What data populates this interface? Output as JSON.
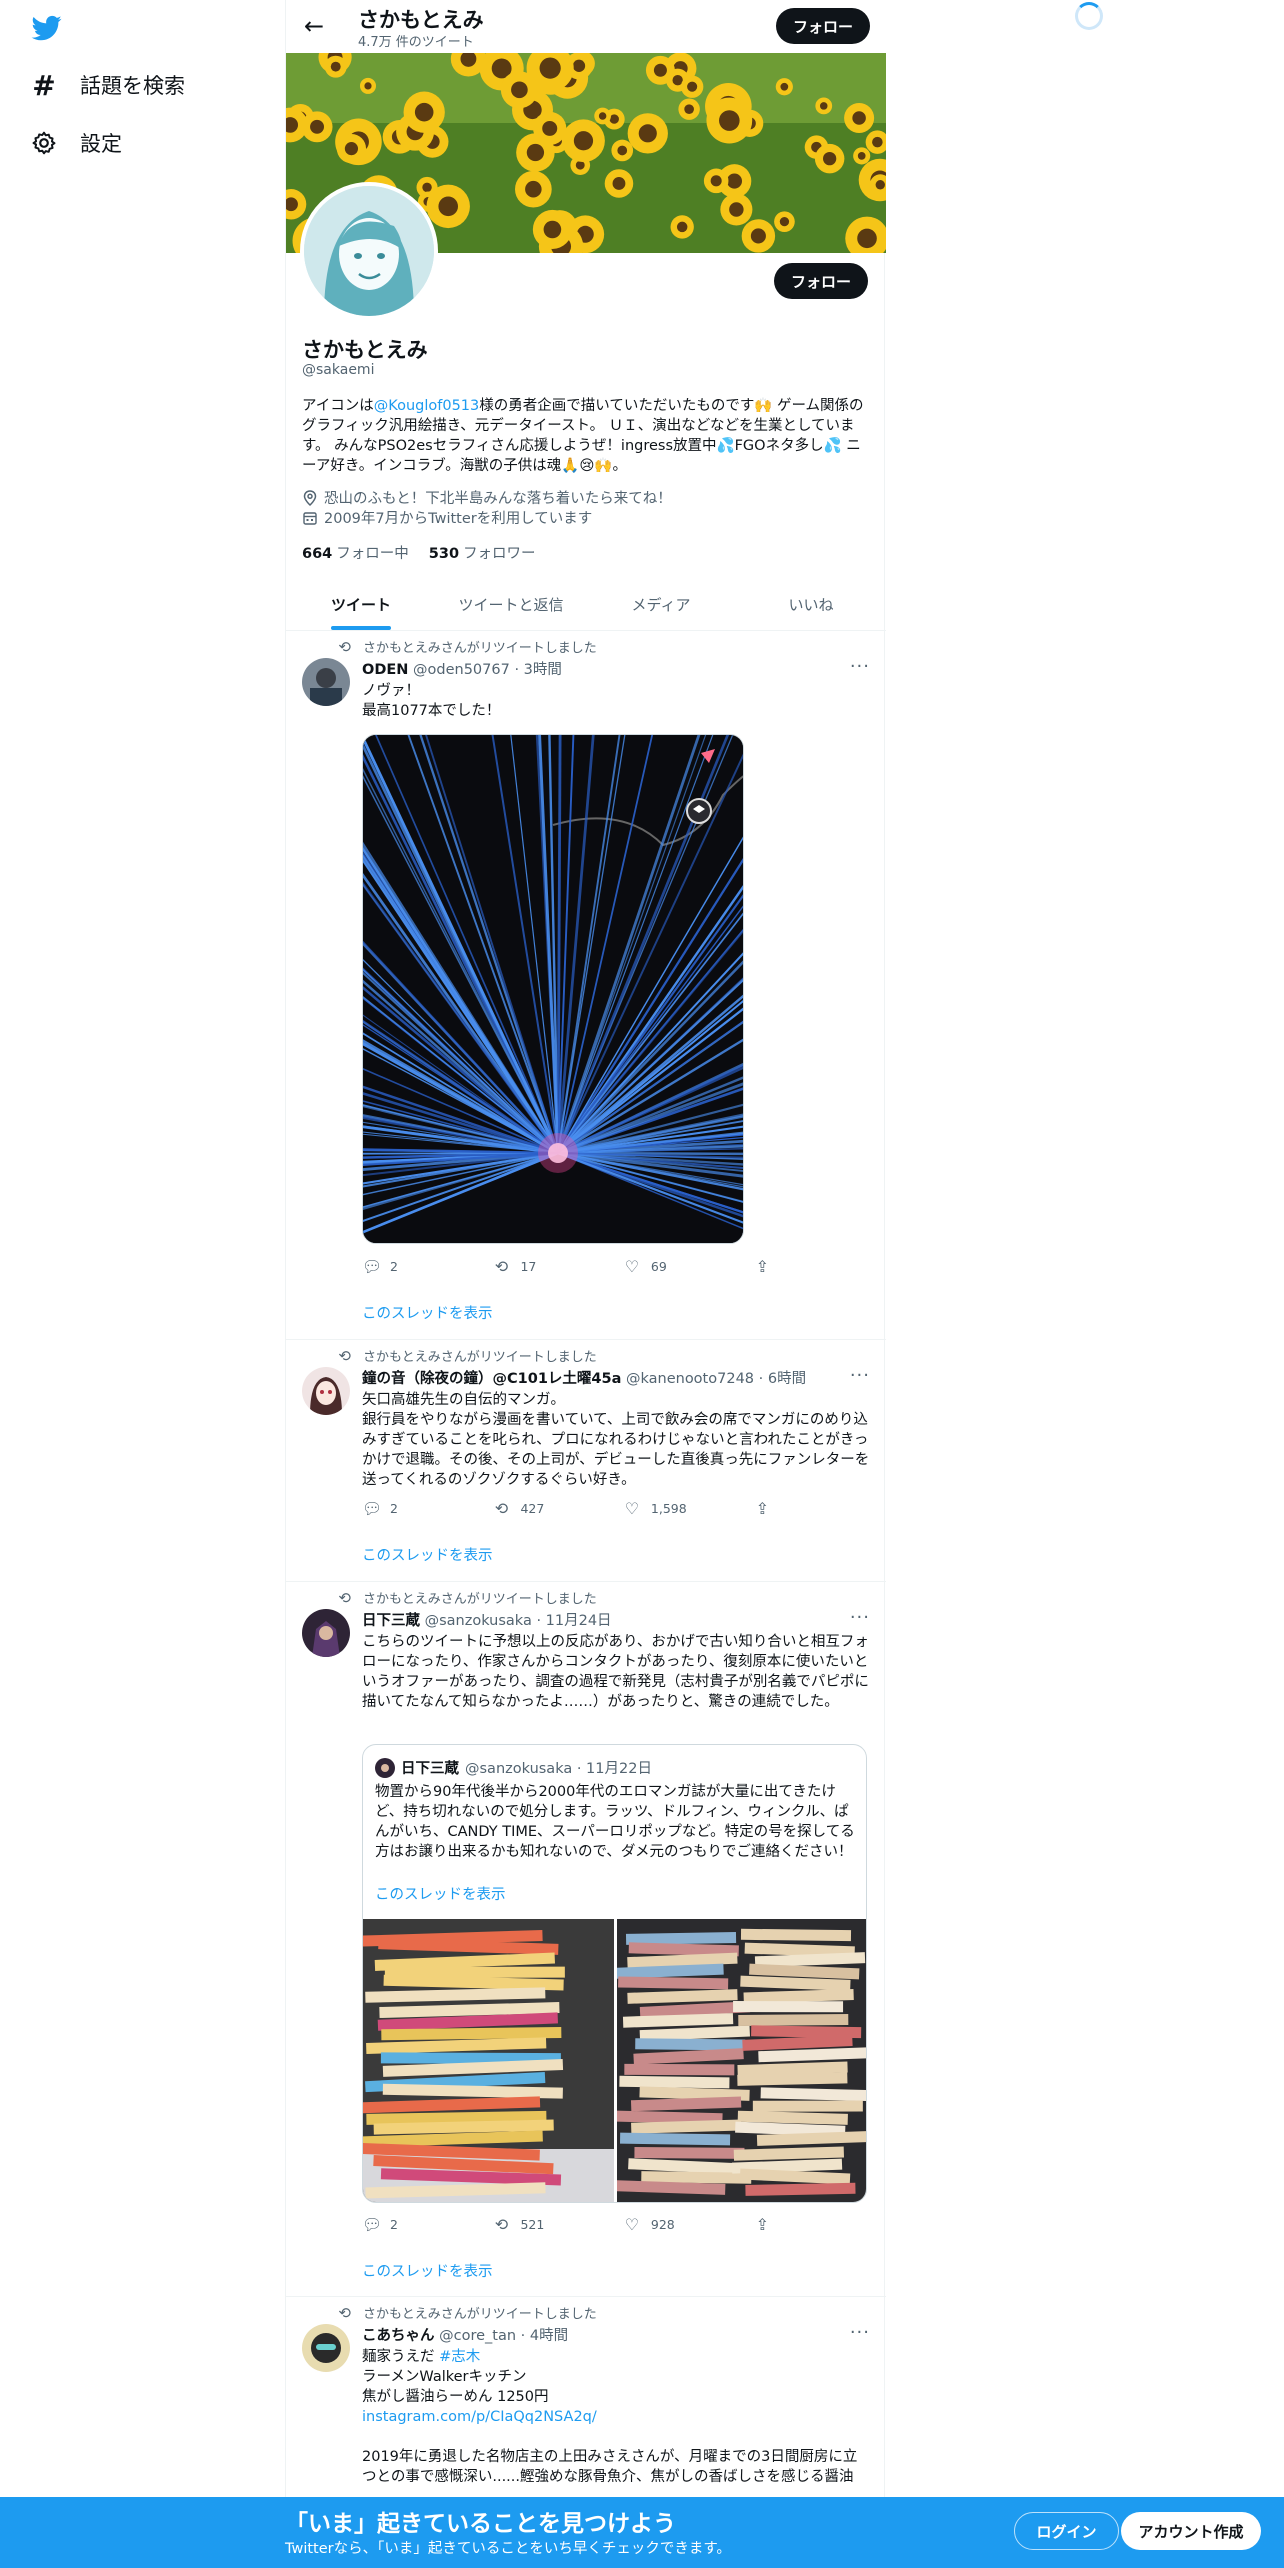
{
  "colors": {
    "accent": "#1d9bf0",
    "text": "#0f1419",
    "muted": "#536471",
    "follow_button": "#0f1419",
    "bottom_bar": "#1d9bf0"
  },
  "nav": {
    "logo_icon": "twitter-bird-icon",
    "items": [
      {
        "label": "話題を検索",
        "icon": "hashtag-icon"
      },
      {
        "label": "設定",
        "icon": "gear-icon"
      }
    ]
  },
  "header": {
    "name": "さかもとえみ",
    "tweet_count": "4.7万 件のツイート",
    "follow_label": "フォロー"
  },
  "profile": {
    "name": "さかもとえみ",
    "handle": "@sakaemi",
    "follow_label": "フォロー",
    "bio_prefix": "アイコンは",
    "bio_mention": "@Kouglof0513",
    "bio_rest": "様の勇者企画で描いていただいたものです🙌 ゲーム関係のグラフィック汎用絵描き、元データイースト。 ＵＩ、演出などなどを生業としています。 みんなPSO2esセラフィさん応援しようぜ！ingress放置中💦FGOネタ多し💦 ニーア好き。インコラブ。海獣の子供は魂🙏😢🙌。",
    "location": "恐山のふもと！下北半島みんな落ち着いたら来てね！",
    "joined": "2009年7月からTwitterを利用しています",
    "following_count": "664",
    "following_label": "フォロー中",
    "followers_count": "530",
    "followers_label": "フォロワー"
  },
  "tabs": [
    "ツイート",
    "ツイートと返信",
    "メディア",
    "いいね"
  ],
  "tweets": [
    {
      "retweeted_by": "さかもとえみさんがリツイートしました",
      "name": "ODEN",
      "meta": "@oden50767 · 3時間",
      "text": "ノヴァ！\n最高1077本でした！",
      "replies": "2",
      "retweets": "17",
      "likes": "69",
      "thread": "このスレッドを表示"
    },
    {
      "retweeted_by": "さかもとえみさんがリツイートしました",
      "name": "鐘の音（除夜の鐘）@C101レ土曜45a",
      "meta": "@kanenooto7248 · 6時間",
      "text": "矢口高雄先生の自伝的マンガ。\n銀行員をやりながら漫画を書いていて、上司で飲み会の席でマンガにのめり込みすぎていることを叱られ、プロになれるわけじゃないと言われたことがきっかけで退職。その後、その上司が、デビューした直後真っ先にファンレターを送ってくれるのゾクゾクするぐらい好き。",
      "replies": "2",
      "retweets": "427",
      "likes": "1,598",
      "thread": "このスレッドを表示"
    },
    {
      "retweeted_by": "さかもとえみさんがリツイートしました",
      "name": "日下三蔵",
      "meta": "@sanzokusaka · 11月24日",
      "text": "こちらのツイートに予想以上の反応があり、おかげで古い知り合いと相互フォローになったり、作家さんからコンタクトがあったり、復刻原本に使いたいというオファーがあったり、調査の過程で新発見（志村貴子が別名義でパピポに描いてたなんて知らなかったよ……）があったりと、驚きの連続でした。",
      "quote": {
        "name": "日下三蔵",
        "meta": "@sanzokusaka · 11月22日",
        "text": "物置から90年代後半から2000年代のエロマンガ誌が大量に出てきたけど、持ち切れないので処分します。ラッツ、ドルフィン、ウィンクル、ぱんがいち、CANDY TIME、スーパーロリポップなど。特定の号を探してる方はお譲り出来るかも知れないので、ダメ元のつもりでご連絡ください！",
        "thread": "このスレッドを表示"
      },
      "replies": "2",
      "retweets": "521",
      "likes": "928",
      "thread": "このスレッドを表示"
    },
    {
      "retweeted_by": "さかもとえみさんがリツイートしました",
      "name": "こあちゃん",
      "meta": "@core_tan · 4時間",
      "line1_prefix": "麺家うえだ ",
      "line1_tag": "#志木",
      "line2": "ラーメンWalkerキッチン",
      "line3": "焦がし醤油らーめん 1250円",
      "link": "instagram.com/p/CIaQq2NSA2q/",
      "text_rest": "2019年に勇退した名物店主の上田みさえさんが、月曜までの3日間厨房に立つとの事で感慨深い......鰹強めな豚骨魚介、焦がしの香ばしさを感じる醤油"
    }
  ],
  "bottom_bar": {
    "title": "「いま」起きていることを見つけよう",
    "subtitle": "Twitterなら、「いま」起きていることをいち早くチェックできます。",
    "login": "ログイン",
    "signup": "アカウント作成"
  }
}
